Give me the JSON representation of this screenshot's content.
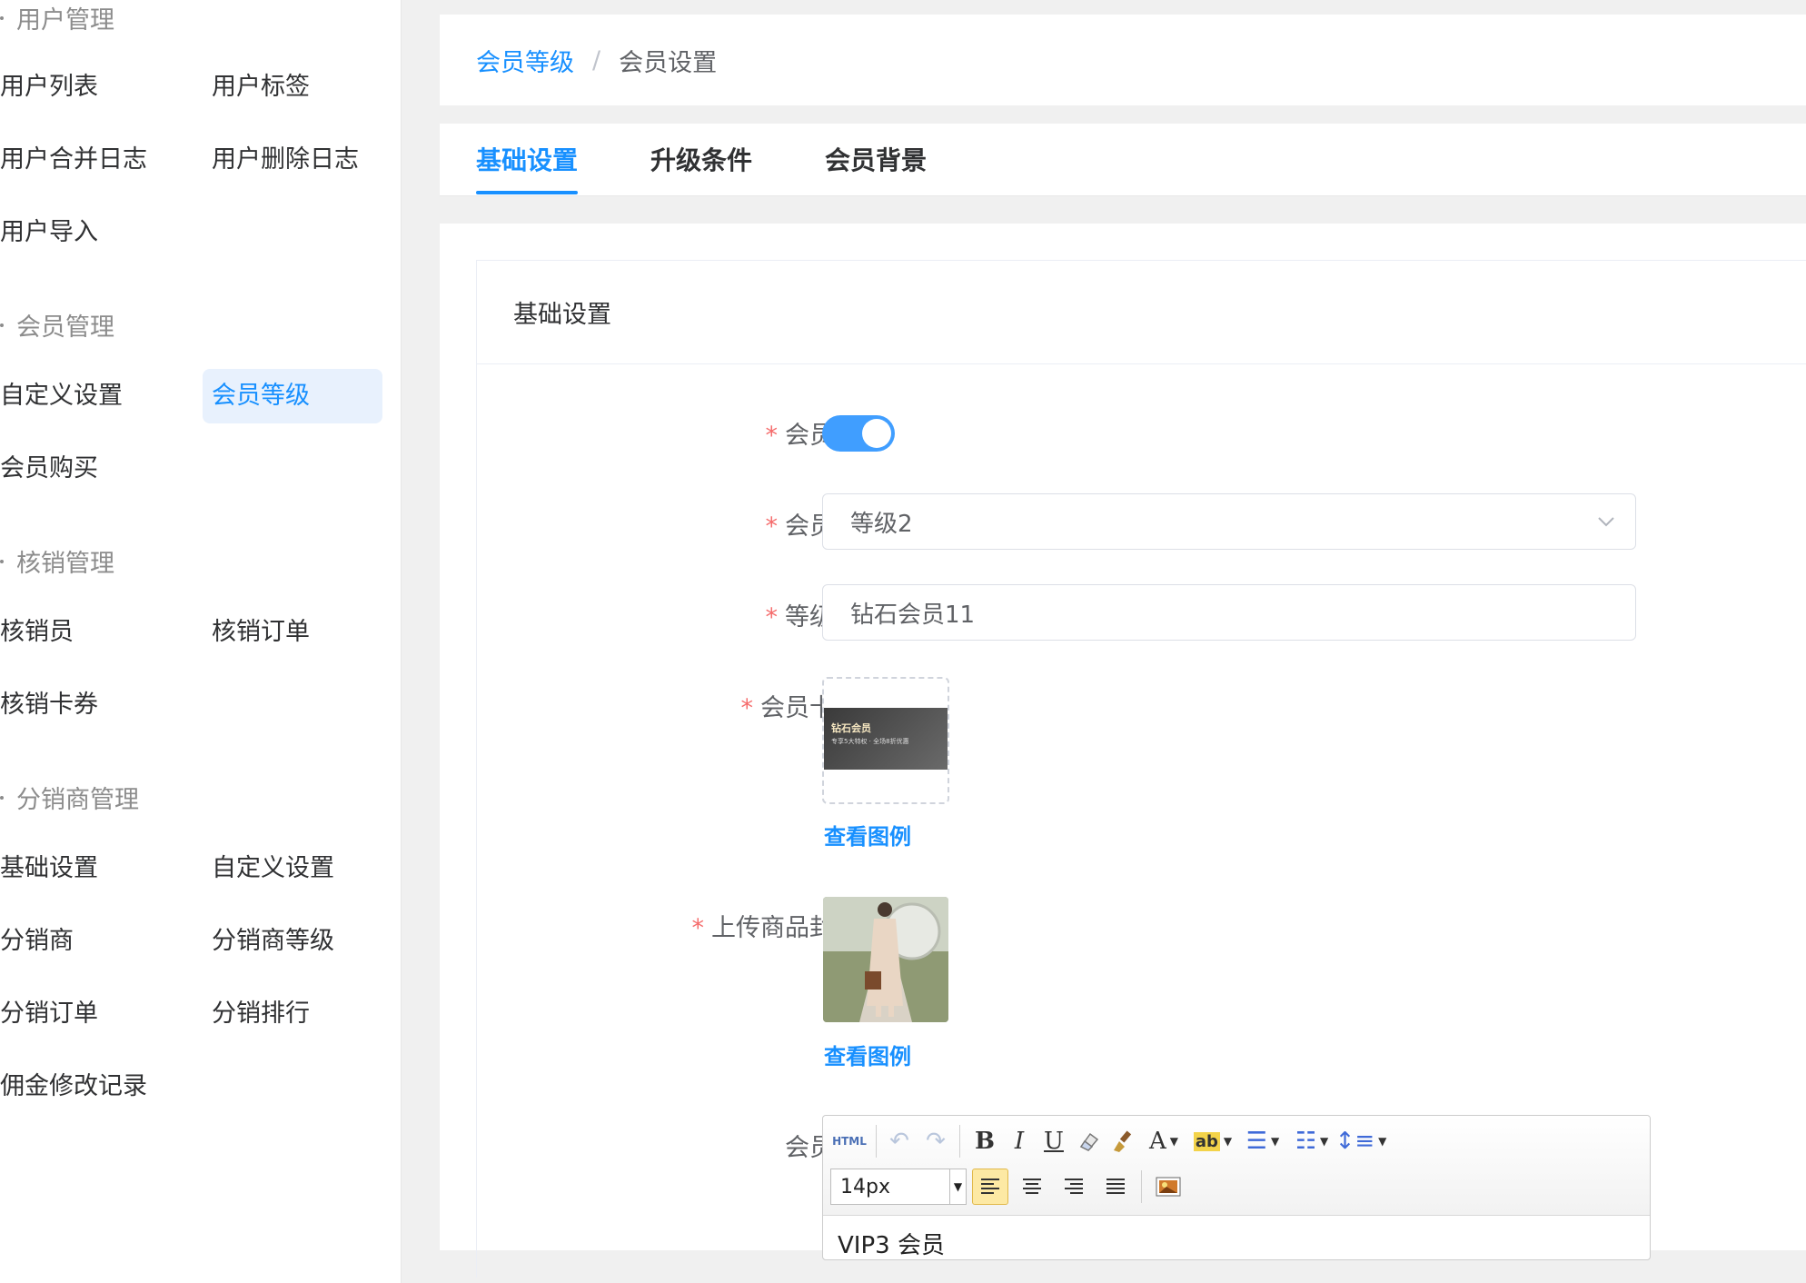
{
  "sidebar": {
    "groups": [
      {
        "title": "用户管理",
        "items": [
          "用户列表",
          "用户标签",
          "用户合并日志",
          "用户删除日志",
          "用户导入"
        ]
      },
      {
        "title": "会员管理",
        "items": [
          "自定义设置",
          "会员等级",
          "会员购买"
        ]
      },
      {
        "title": "核销管理",
        "items": [
          "核销员",
          "核销订单",
          "核销卡券"
        ]
      },
      {
        "title": "分销商管理",
        "items": [
          "基础设置",
          "自定义设置",
          "分销商",
          "分销商等级",
          "分销订单",
          "分销排行",
          "佣金修改记录"
        ]
      }
    ],
    "active_item": "会员等级"
  },
  "breadcrumb": {
    "parent": "会员等级",
    "separator": "/",
    "current": "会员设置"
  },
  "tabs": [
    {
      "label": "基础设置",
      "active": true
    },
    {
      "label": "升级条件",
      "active": false
    },
    {
      "label": "会员背景",
      "active": false
    }
  ],
  "section": {
    "title": "基础设置"
  },
  "form": {
    "required_mark": "*",
    "status": {
      "label": "会员状态",
      "enabled": true
    },
    "level": {
      "label": "会员等级",
      "value": "等级2"
    },
    "level_name": {
      "label": "等级名称",
      "value": "钻石会员11"
    },
    "card_cover": {
      "label": "会员卡封面",
      "cover_title": "钻石会员",
      "cover_subtitle": "专享5大特权 · 全场8折优惠",
      "view_link": "查看图例"
    },
    "product_cover": {
      "label": "上传商品封面图",
      "view_link": "查看图例"
    },
    "rules": {
      "label": "会员规则",
      "font_size": "14px",
      "html_btn": "HTML",
      "content": "VIP3 会员"
    }
  },
  "colors": {
    "accent": "#1890ff",
    "required": "#f56c6c",
    "switch_on": "#409eff"
  }
}
